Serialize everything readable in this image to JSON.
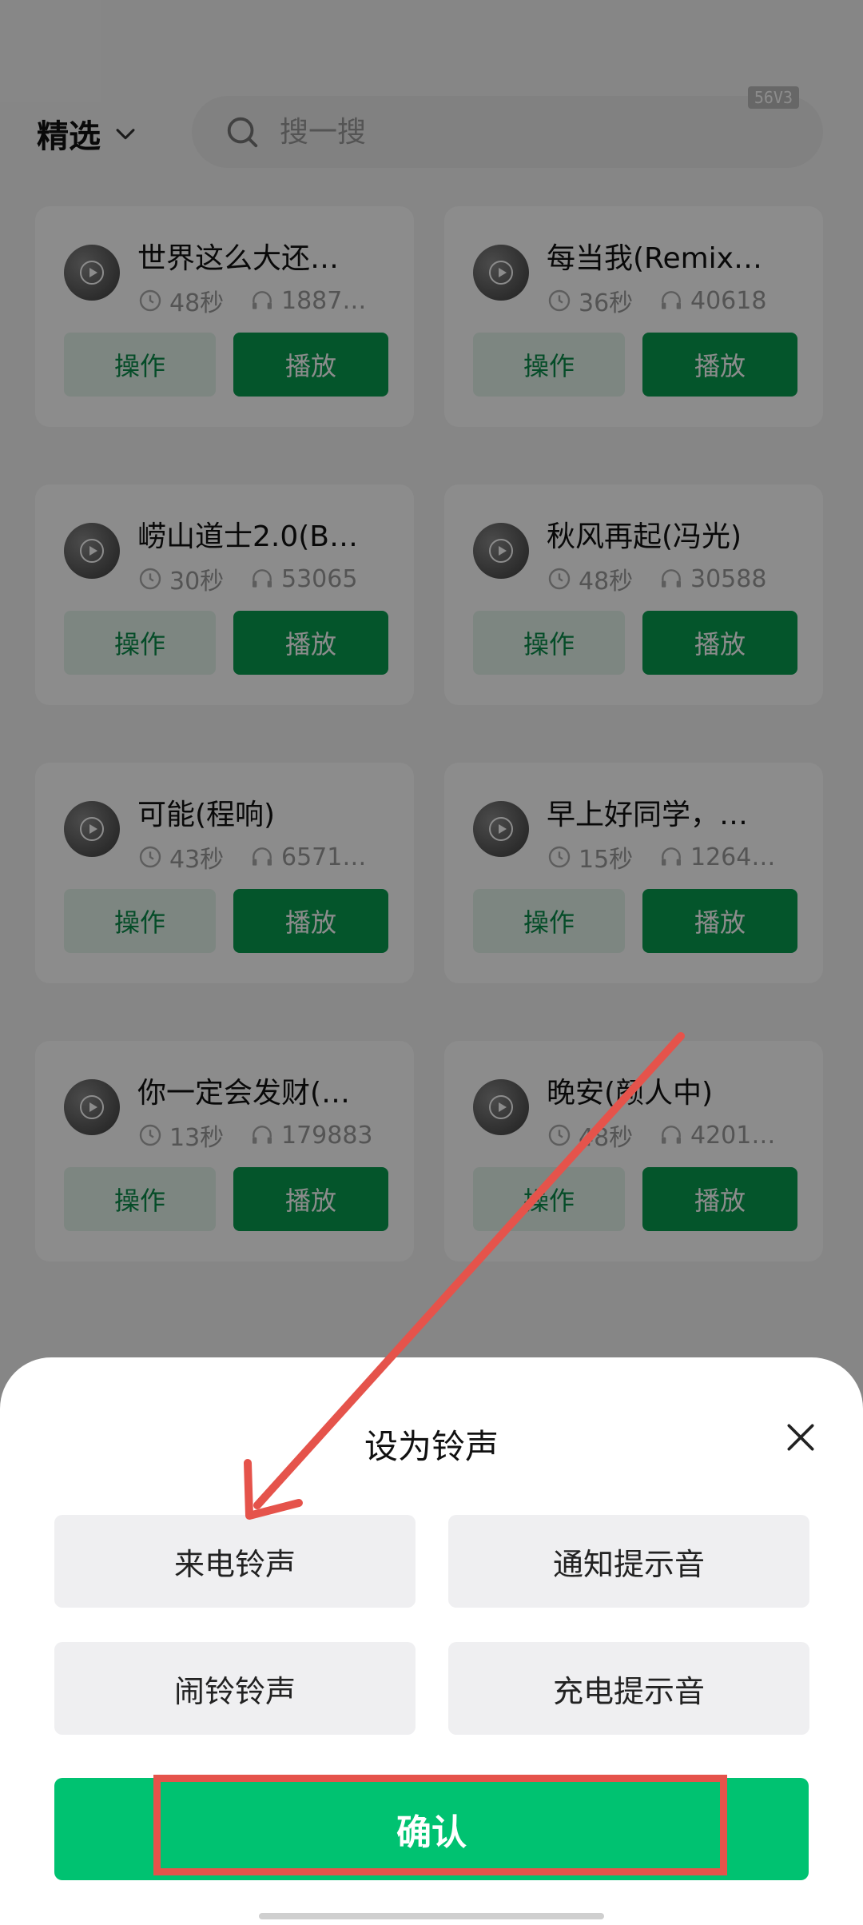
{
  "header": {
    "category": "精选",
    "search_placeholder": "搜一搜",
    "badge": "56V3"
  },
  "songs": [
    {
      "title": "世界这么大还…",
      "duration": "48秒",
      "plays": "1887…",
      "op": "操作",
      "play": "播放"
    },
    {
      "title": "每当我(Remix…",
      "duration": "36秒",
      "plays": "40618",
      "op": "操作",
      "play": "播放"
    },
    {
      "title": "崂山道士2.0(B…",
      "duration": "30秒",
      "plays": "53065",
      "op": "操作",
      "play": "播放"
    },
    {
      "title": "秋风再起(冯光)",
      "duration": "48秒",
      "plays": "30588",
      "op": "操作",
      "play": "播放"
    },
    {
      "title": "可能(程响)",
      "duration": "43秒",
      "plays": "6571…",
      "op": "操作",
      "play": "播放"
    },
    {
      "title": "早上好同学，…",
      "duration": "15秒",
      "plays": "1264…",
      "op": "操作",
      "play": "播放"
    },
    {
      "title": "你一定会发财(…",
      "duration": "13秒",
      "plays": "179883",
      "op": "操作",
      "play": "播放"
    },
    {
      "title": "晚安(颜人中)",
      "duration": "48秒",
      "plays": "4201…",
      "op": "操作",
      "play": "播放"
    }
  ],
  "sheet": {
    "title": "设为铃声",
    "options": [
      "来电铃声",
      "通知提示音",
      "闹铃铃声",
      "充电提示音"
    ],
    "confirm": "确认"
  },
  "colors": {
    "primary_green": "#089b4f",
    "confirm_green": "#00c271",
    "annotation_red": "#e5534b"
  }
}
